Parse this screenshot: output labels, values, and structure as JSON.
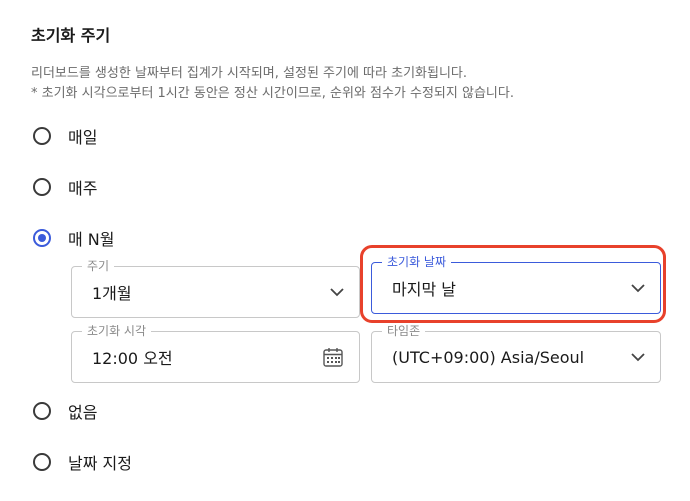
{
  "section": {
    "title": "초기화 주기",
    "desc_line1": "리더보드를 생성한 날짜부터 집계가 시작되며, 설정된 주기에 따라 초기화됩니다.",
    "desc_line2": "* 초기화 시각으로부터 1시간 동안은 정산 시간이므로, 순위와 점수가 수정되지 않습니다."
  },
  "options": [
    {
      "label": "매일",
      "checked": false
    },
    {
      "label": "매주",
      "checked": false
    },
    {
      "label": "매 N월",
      "checked": true
    },
    {
      "label": "없음",
      "checked": false
    },
    {
      "label": "날짜 지정",
      "checked": false
    }
  ],
  "fields": {
    "period": {
      "legend": "주기",
      "value": "1개월"
    },
    "reset_day": {
      "legend": "초기화 날짜",
      "value": "마지막 날"
    },
    "reset_time": {
      "legend": "초기화 시각",
      "value": "12:00 오전"
    },
    "timezone": {
      "legend": "타임존",
      "value": "(UTC+09:00) Asia/Seoul"
    }
  },
  "colors": {
    "accent": "#3b5bdb",
    "highlight": "#e8412b"
  },
  "icons": {
    "calendar": "calendar-icon",
    "chevron": "chevron-down-icon"
  }
}
